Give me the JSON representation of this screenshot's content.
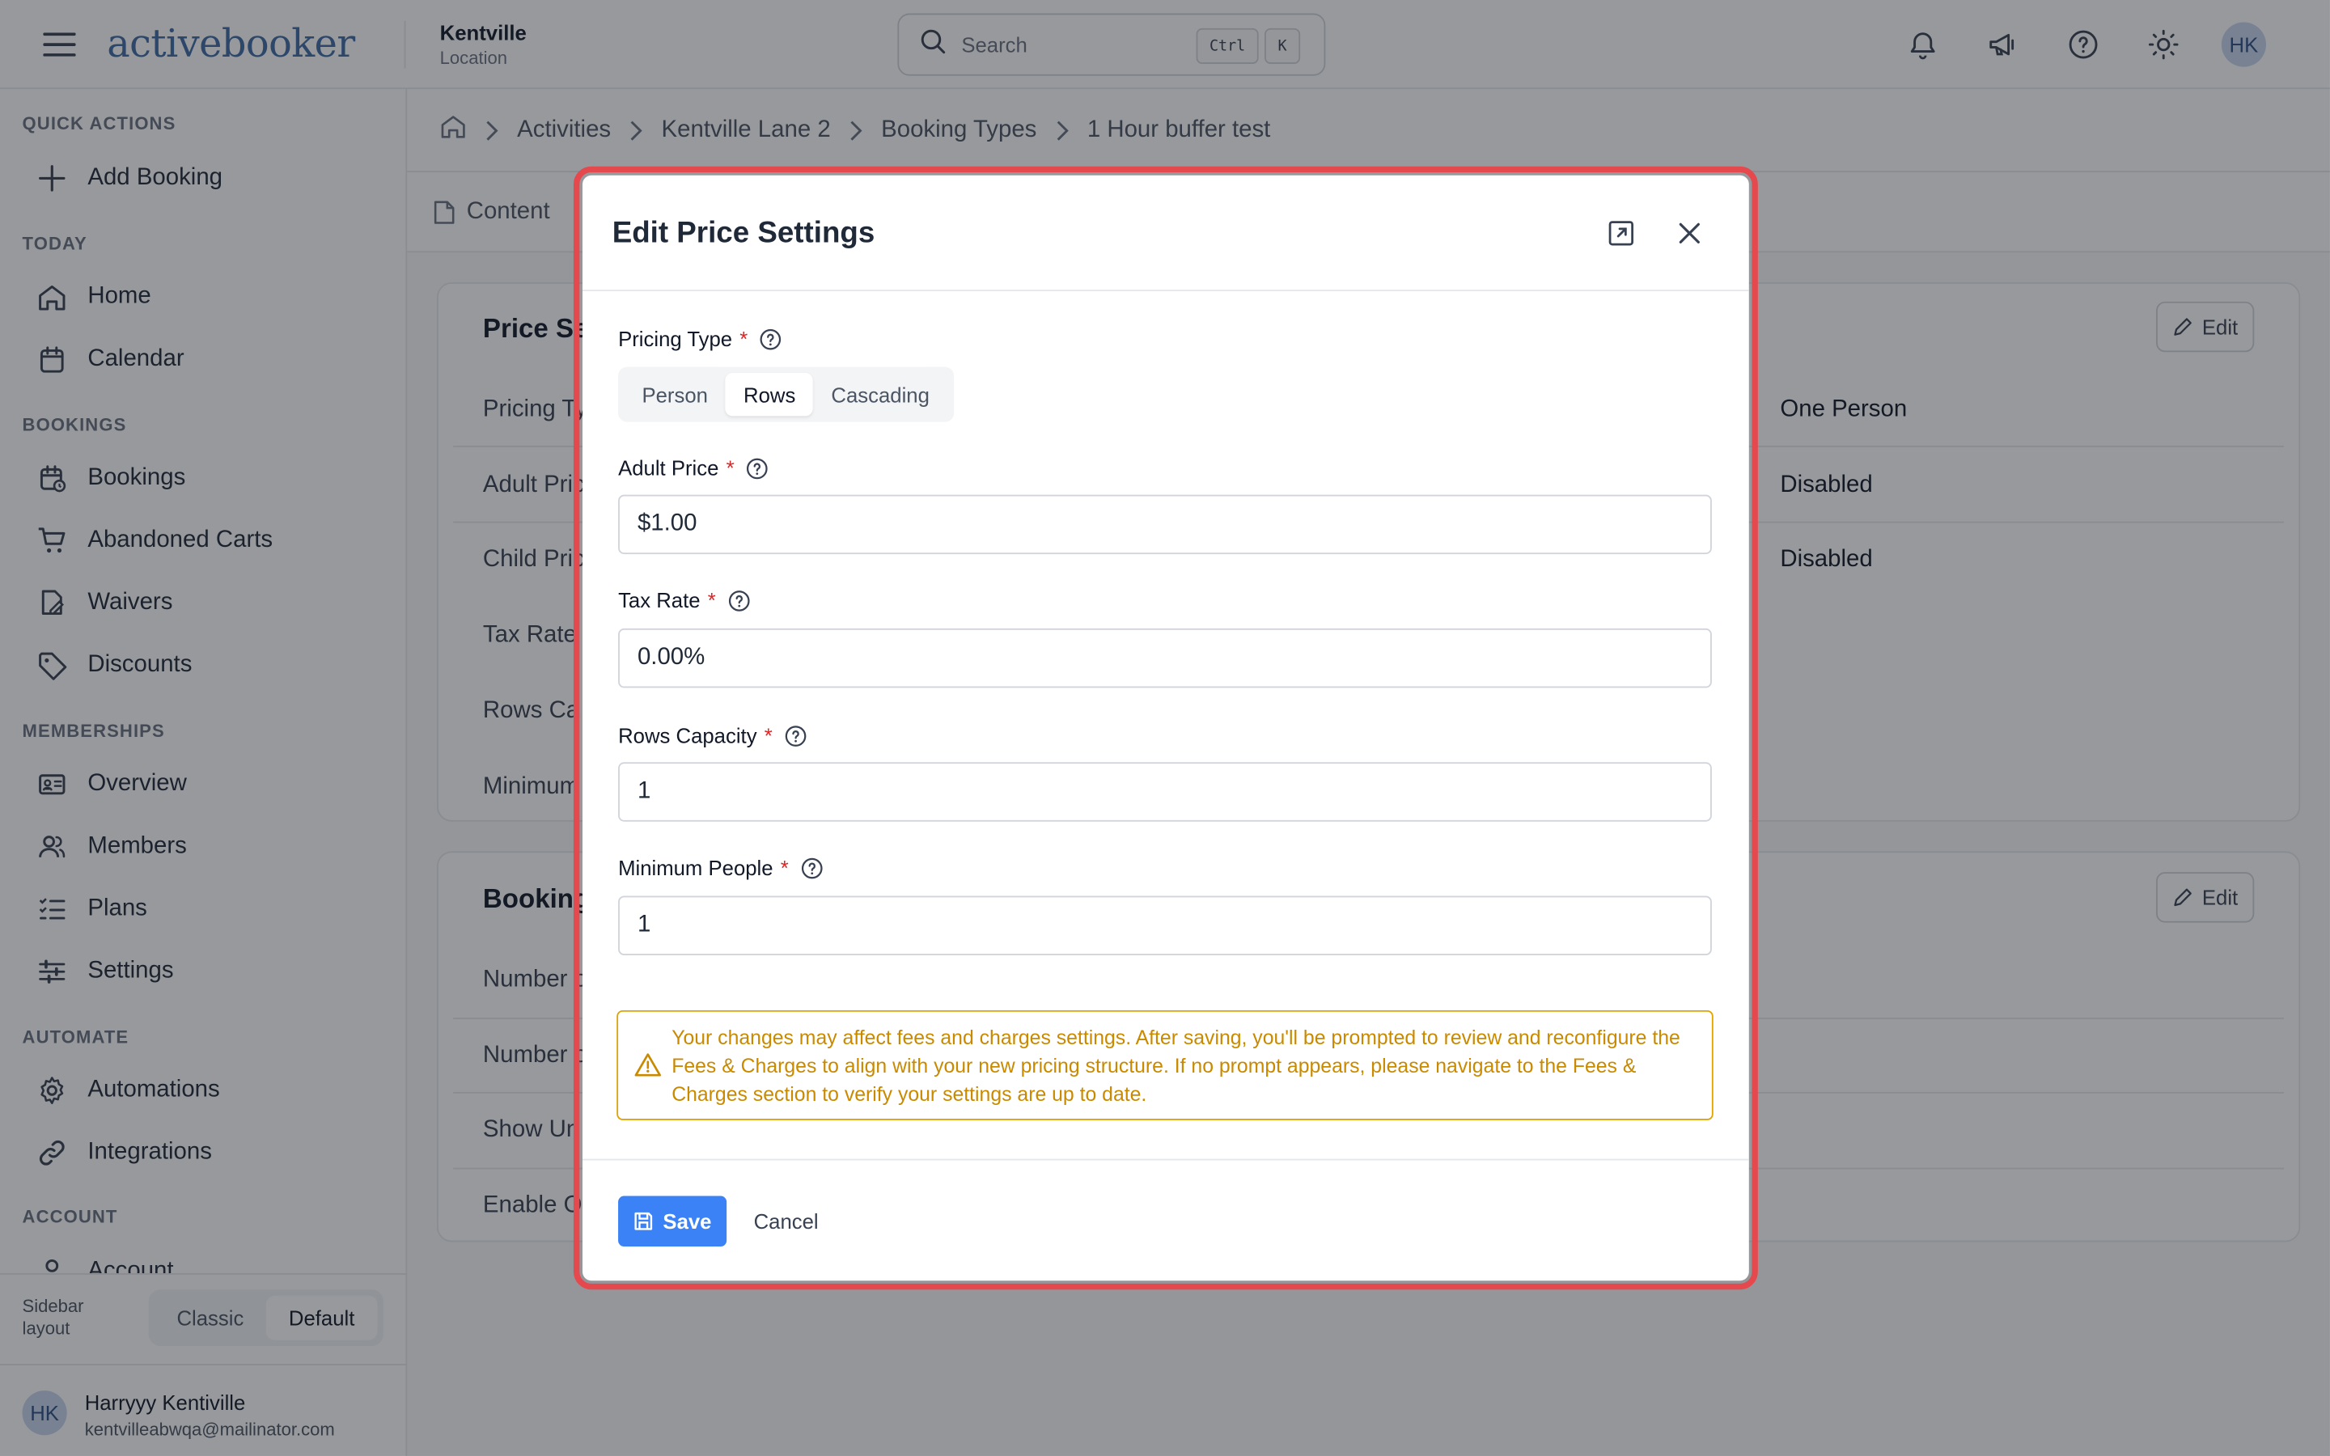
{
  "header": {
    "logo_text": "activebooker",
    "location_name": "Kentville",
    "location_sub": "Location",
    "search_placeholder": "Search",
    "shortcut_ctrl": "Ctrl",
    "shortcut_key": "K",
    "avatar_initials": "HK"
  },
  "sidebar": {
    "sections": {
      "quick_actions": "QUICK ACTIONS",
      "today": "TODAY",
      "bookings": "BOOKINGS",
      "memberships": "MEMBERSHIPS",
      "automate": "AUTOMATE",
      "account": "ACCOUNT"
    },
    "items": {
      "add_booking": "Add Booking",
      "home": "Home",
      "calendar": "Calendar",
      "bookings": "Bookings",
      "abandoned_carts": "Abandoned Carts",
      "waivers": "Waivers",
      "discounts": "Discounts",
      "overview": "Overview",
      "members": "Members",
      "plans": "Plans",
      "settings": "Settings",
      "automations": "Automations",
      "integrations": "Integrations",
      "account": "Account"
    },
    "layout_label": "Sidebar layout",
    "layout_options": [
      "Classic",
      "Default"
    ],
    "layout_selected": "Default",
    "user": {
      "initials": "HK",
      "name": "Harryyy Kentiville",
      "email": "kentvilleabwqa@mailinator.com"
    }
  },
  "breadcrumb": [
    "Activities",
    "Kentville Lane 2",
    "Booking Types",
    "1 Hour buffer test"
  ],
  "tabs": {
    "content": "Content"
  },
  "price_card": {
    "title": "Price Se",
    "edit_label": "Edit",
    "rows": [
      {
        "label": "Pricing Ty",
        "value": "One Person"
      },
      {
        "label": "Adult Pric",
        "value": "Disabled"
      },
      {
        "label": "Child Pric",
        "value": "Disabled"
      },
      {
        "label": "Tax Rate",
        "value": ""
      },
      {
        "label": "Rows Ca",
        "value": ""
      },
      {
        "label": "Minimum",
        "value": ""
      }
    ]
  },
  "booking_card": {
    "title": "Booking",
    "edit_label": "Edit",
    "rows": [
      {
        "label": "Number o"
      },
      {
        "label": "Number o"
      },
      {
        "label": "Show Un"
      },
      {
        "label": "Enable O"
      }
    ]
  },
  "modal": {
    "title": "Edit Price Settings",
    "pricing_type_label": "Pricing Type",
    "pricing_type_options": [
      "Person",
      "Rows",
      "Cascading"
    ],
    "pricing_type_selected": "Rows",
    "adult_price_label": "Adult Price",
    "adult_price_value": "$1.00",
    "tax_rate_label": "Tax Rate",
    "tax_rate_value": "0.00%",
    "rows_capacity_label": "Rows Capacity",
    "rows_capacity_value": "1",
    "minimum_people_label": "Minimum People",
    "minimum_people_value": "1",
    "required_mark": "*",
    "warning_text": "Your changes may affect fees and charges settings. After saving, you'll be prompted to review and reconfigure the Fees & Charges to align with your new pricing structure. If no prompt appears, please navigate to the Fees & Charges section to verify your settings are up to date.",
    "save_label": "Save",
    "cancel_label": "Cancel"
  },
  "colors": {
    "primary": "#3b82f6",
    "highlight_border": "#e5484d",
    "warning": "#c98a00",
    "brand": "#3f6aa5"
  }
}
